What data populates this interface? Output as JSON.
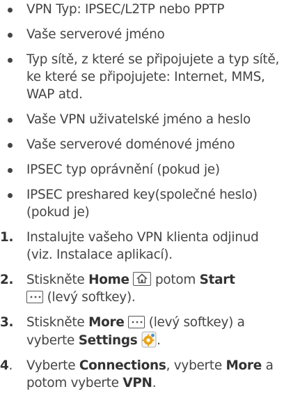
{
  "bullets": [
    "VPN Typ: IPSEC/L2TP nebo PPTP",
    "Vaše serverové jméno",
    "Typ sítě, z které se připojujete a typ sítě, ke které se připojujete: Internet, MMS, WAP atd.",
    "Vaše VPN uživatelské jméno a heslo",
    "Vaše serverové doménové jméno",
    "IPSEC typ oprávnění (pokud je)",
    "IPSEC preshared key(společné heslo) (pokud je)"
  ],
  "steps": [
    {
      "num": "1.",
      "text": "Instalujte vašeho VPN klienta odjinud (viz. Instalace aplikací)."
    },
    {
      "num": "2.",
      "t1": "Stiskněte ",
      "b1": "Home",
      "t2": " potom ",
      "b2": "Start",
      "t3": " (levý softkey)."
    },
    {
      "num": "3.",
      "t1": "Stiskněte ",
      "b1": "More",
      "t2": " (levý softkey) a vyberte ",
      "b2": "Settings",
      "t3": "."
    },
    {
      "num": "4",
      "num_dot": ".",
      "t1": " Vyberte ",
      "b1": "Connections",
      "t2": ", vyberte ",
      "b2": "More",
      "t3": " a potom vyberte ",
      "b3": "VPN",
      "t4": "."
    }
  ],
  "icons": {
    "home": "home-icon",
    "more": "more-dots-icon",
    "settings": "settings-gear-icon"
  },
  "colors": {
    "text": "#444444",
    "bold_text": "#333333",
    "settings_icon": "#e8a317"
  }
}
